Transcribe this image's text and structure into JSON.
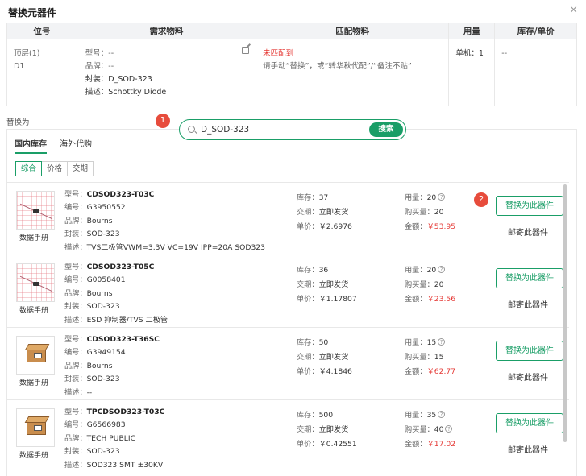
{
  "dialog": {
    "title": "替换元器件",
    "close": "×"
  },
  "bom_table": {
    "headers": [
      "位号",
      "需求物料",
      "匹配物料",
      "用量",
      "库存/单价"
    ],
    "row": {
      "location": "顶层(1)",
      "designator": "D1",
      "required": [
        {
          "key": "型号：",
          "value": "--"
        },
        {
          "key": "品牌：",
          "value": "--"
        },
        {
          "key": "封装：",
          "value": "D_SOD-323"
        },
        {
          "key": "描述：",
          "value": "Schottky Diode"
        }
      ],
      "match_status": "未匹配到",
      "match_hint": "请手动“替换”，或“转华秋代配”/“备注不贴”",
      "usage": "单机：1",
      "stock_price": "--"
    }
  },
  "replace_label": "替换为",
  "badges": [
    "1",
    "2"
  ],
  "search": {
    "value": "D_SOD-323",
    "button": "搜索"
  },
  "tabs": [
    {
      "label": "国内库存",
      "active": true
    },
    {
      "label": "海外代购",
      "active": false
    }
  ],
  "sort_options": [
    {
      "label": "综合",
      "active": true
    },
    {
      "label": "价格",
      "active": false
    },
    {
      "label": "交期",
      "active": false
    }
  ],
  "item_labels": {
    "datasheet": "数据手册",
    "model": "型号：",
    "code": "编号：",
    "brand": "品牌：",
    "package": "封装：",
    "desc": "描述：",
    "stock": "库存：",
    "lead": "交期：",
    "unit_price": "单价：",
    "usage": "用量：",
    "buy_qty": "购买量：",
    "amount": "金额：",
    "replace_btn": "替换为此器件",
    "mail_btn": "邮寄此器件"
  },
  "items": [
    {
      "thumb": "grid",
      "model": "CDSOD323-T03C",
      "code": "G3950552",
      "brand": "Bourns",
      "package": "SOD-323",
      "desc": "TVS二极管VWM=3.3V VC=19V IPP=20A SOD323",
      "stock": "37",
      "lead": "立即发货",
      "unit_price": "￥2.6976",
      "usage": "20",
      "buy_qty": "20",
      "amount": "￥53.95",
      "buy_info": false
    },
    {
      "thumb": "grid",
      "model": "CDSOD323-T05C",
      "code": "G0058401",
      "brand": "Bourns",
      "package": "SOD-323",
      "desc": "ESD 抑制器/TVS 二极管",
      "stock": "36",
      "lead": "立即发货",
      "unit_price": "￥1.17807",
      "usage": "20",
      "buy_qty": "20",
      "amount": "￥23.56",
      "buy_info": false
    },
    {
      "thumb": "box",
      "model": "CDSOD323-T36SC",
      "code": "G3949154",
      "brand": "Bourns",
      "package": "SOD-323",
      "desc": "--",
      "stock": "50",
      "lead": "立即发货",
      "unit_price": "￥4.1846",
      "usage": "15",
      "buy_qty": "15",
      "amount": "￥62.77",
      "buy_info": false
    },
    {
      "thumb": "box",
      "model": "TPCDSOD323-T03C",
      "code": "G6566983",
      "brand": "TECH PUBLIC",
      "package": "SOD-323",
      "desc": "SOD323 SMT ±30KV",
      "stock": "500",
      "lead": "立即发货",
      "unit_price": "￥0.42551",
      "usage": "35",
      "buy_qty": "40",
      "amount": "￥17.02",
      "buy_info": true
    }
  ]
}
